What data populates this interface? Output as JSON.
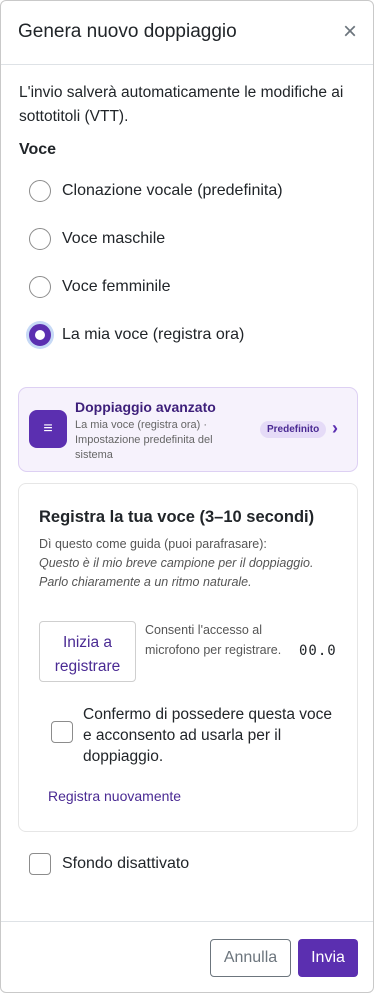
{
  "dialog": {
    "title": "Genera nuovo doppiaggio",
    "close_glyph": "×",
    "info": "L'invio salverà automaticamente le modifiche ai sottotitoli (VTT)."
  },
  "voice": {
    "label": "Voce",
    "selected": "La mia voce (registra ora)",
    "options": [
      "Clonazione vocale (predefinita)",
      "Voce maschile",
      "Voce femminile",
      "La mia voce (registra ora)"
    ]
  },
  "advanced": {
    "icon": "list-icon",
    "icon_glyph": "≡",
    "title": "Doppiaggio avanzato",
    "subtitle": "La mia voce (registra ora) · Impostazione predefinita del sistema",
    "badge": "Predefinito",
    "chevron_glyph": "›"
  },
  "recording": {
    "title": "Registra la tua voce (3–10 secondi)",
    "guide_intro": "Dì questo come guida (puoi parafrasare):",
    "guide_text": "Questo è il mio breve campione per il doppiaggio. Parlo chiaramente a un ritmo naturale.",
    "start_button": "Inizia a registrare",
    "mic_hint": "Consenti l'accesso al microfono per registrare.",
    "timer": "00.0",
    "consent_text": "Confermo di possedere questa voce e acconsento ad usarla per il doppiaggio.",
    "consent_checked": false,
    "rerecord_link": "Registra nuovamente"
  },
  "background": {
    "label": "Sfondo disattivato",
    "checked": false
  },
  "footer": {
    "cancel_label": "Annulla",
    "submit_label": "Invia"
  },
  "colors": {
    "accent": "#5b2fb0",
    "accent_soft": "#f6f2fc"
  }
}
